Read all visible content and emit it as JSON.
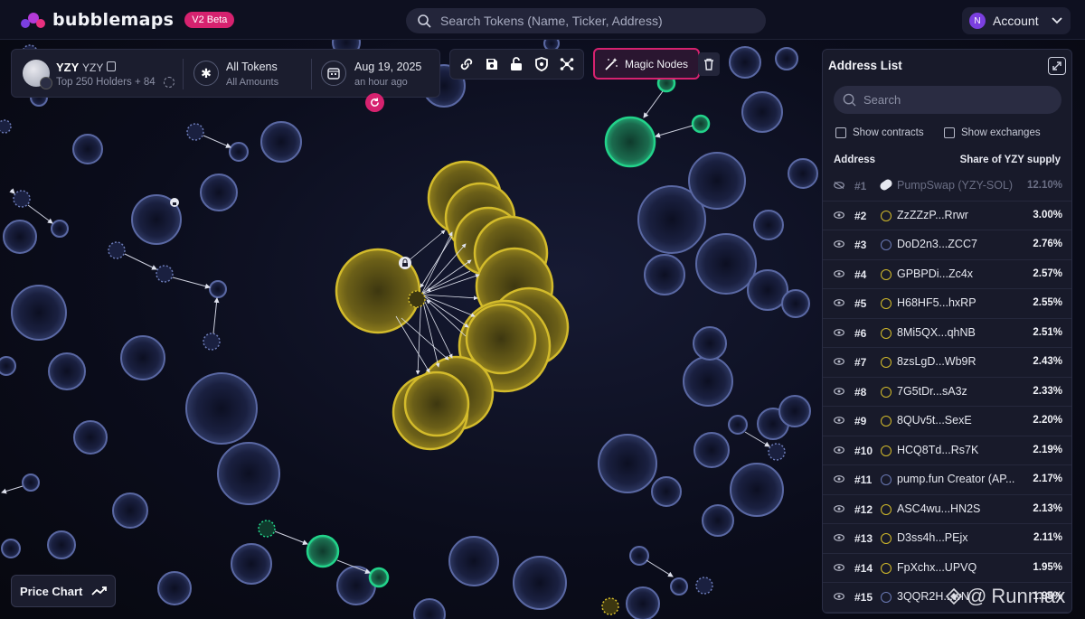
{
  "app": {
    "name": "bubblemaps",
    "badge": "V2 Beta"
  },
  "search": {
    "placeholder": "Search Tokens (Name, Ticker, Address)"
  },
  "account": {
    "initial": "N",
    "label": "Account"
  },
  "token": {
    "name": "YZY",
    "ticker": "YZY",
    "holders_label": "Top 250 Holders + 84",
    "filter_title": "All Tokens",
    "filter_sub": "All Amounts",
    "date": "Aug 19, 2025",
    "date_sub": "an hour ago"
  },
  "toolbar": {
    "magic_label": "Magic Nodes"
  },
  "address_list": {
    "title": "Address List",
    "search_placeholder": "Search",
    "show_contracts": "Show contracts",
    "show_exchanges": "Show exchanges",
    "col_address": "Address",
    "col_share": "Share of YZY supply",
    "rows": [
      {
        "rank": "#1",
        "address": "PumpSwap (YZY-SOL)",
        "share": "12.10%",
        "kind": "contract"
      },
      {
        "rank": "#2",
        "address": "ZzZZzP...Rrwr",
        "share": "3.00%",
        "kind": "yellow"
      },
      {
        "rank": "#3",
        "address": "DoD2n3...ZCC7",
        "share": "2.76%",
        "kind": "blue"
      },
      {
        "rank": "#4",
        "address": "GPBPDi...Zc4x",
        "share": "2.57%",
        "kind": "yellow"
      },
      {
        "rank": "#5",
        "address": "H68HF5...hxRP",
        "share": "2.55%",
        "kind": "yellow"
      },
      {
        "rank": "#6",
        "address": "8Mi5QX...qhNB",
        "share": "2.51%",
        "kind": "yellow"
      },
      {
        "rank": "#7",
        "address": "8zsLgD...Wb9R",
        "share": "2.43%",
        "kind": "yellow"
      },
      {
        "rank": "#8",
        "address": "7G5tDr...sA3z",
        "share": "2.33%",
        "kind": "yellow"
      },
      {
        "rank": "#9",
        "address": "8QUv5t...SexE",
        "share": "2.20%",
        "kind": "yellow"
      },
      {
        "rank": "#10",
        "address": "HCQ8Td...Rs7K",
        "share": "2.19%",
        "kind": "yellow"
      },
      {
        "rank": "#11",
        "address": "pump.fun Creator (AP...",
        "share": "2.17%",
        "kind": "blue"
      },
      {
        "rank": "#12",
        "address": "ASC4wu...HN2S",
        "share": "2.13%",
        "kind": "yellow"
      },
      {
        "rank": "#13",
        "address": "D3ss4h...PEjx",
        "share": "2.11%",
        "kind": "yellow"
      },
      {
        "rank": "#14",
        "address": "FpXchx...UPVQ",
        "share": "1.95%",
        "kind": "yellow"
      },
      {
        "rank": "#15",
        "address": "3QQR2H...wN",
        "share": "1.95%",
        "kind": "blue"
      }
    ]
  },
  "price_chart": {
    "label": "Price Chart"
  },
  "watermark": {
    "text": "Runmax",
    "prefix": "@"
  },
  "colors": {
    "accent": "#d6226f",
    "cluster": "#d3bb2b",
    "green": "#22d38a",
    "bubble": "#6a79b4"
  }
}
